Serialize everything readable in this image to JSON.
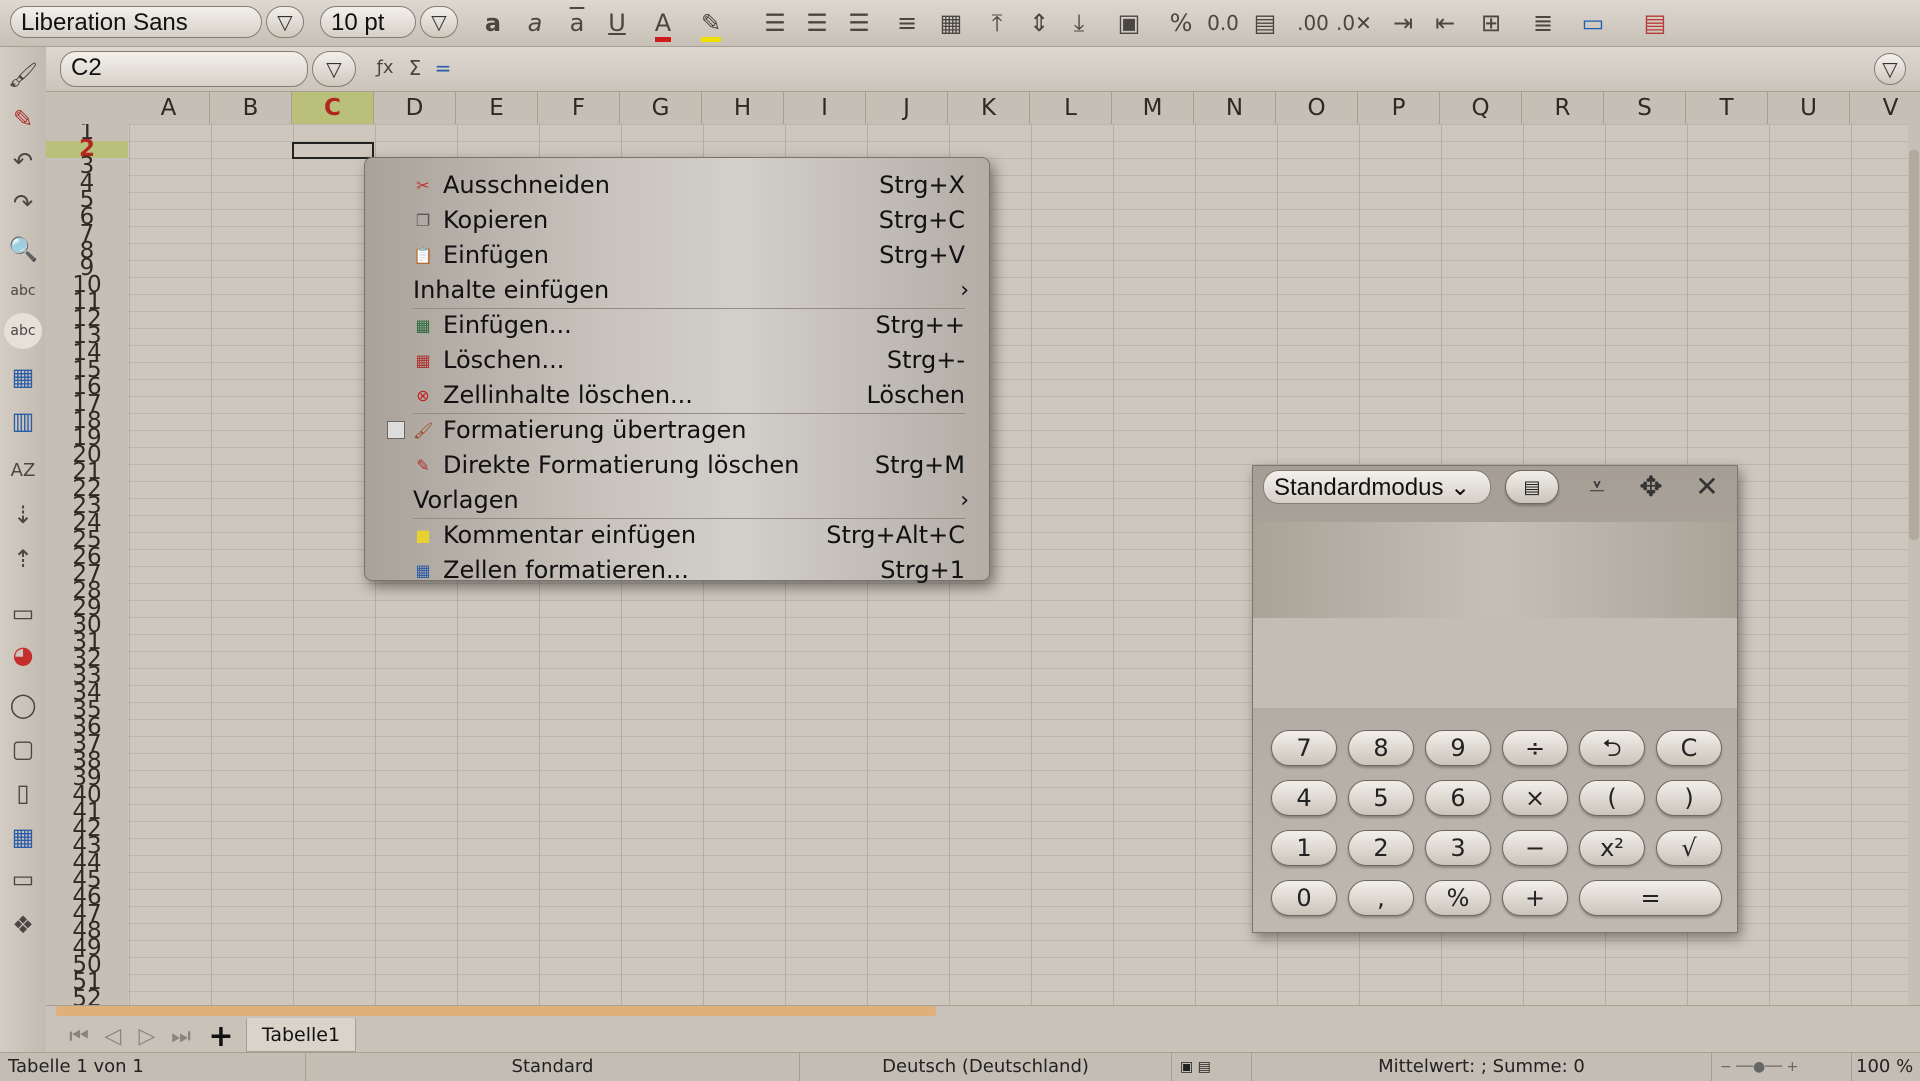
{
  "toolbar": {
    "font_name": "Liberation Sans",
    "font_size": "10 pt",
    "dropdown_glyph": "▽"
  },
  "formula_bar": {
    "name_box": "C2",
    "sum_label": "Σ",
    "equals_label": "="
  },
  "sheet": {
    "columns": [
      "A",
      "B",
      "C",
      "D",
      "E",
      "F",
      "G",
      "H",
      "I",
      "J",
      "K",
      "L",
      "M",
      "N",
      "O",
      "P",
      "Q",
      "R",
      "S",
      "T",
      "U",
      "V"
    ],
    "selected_column": "C",
    "rows": [
      "1",
      "2",
      "3",
      "4",
      "5",
      "6",
      "7",
      "8",
      "9",
      "10",
      "11",
      "12",
      "13",
      "14",
      "15",
      "16",
      "17",
      "18",
      "19",
      "20",
      "21",
      "22",
      "23",
      "24",
      "25",
      "26",
      "27",
      "28",
      "29",
      "30",
      "31",
      "32",
      "33",
      "34",
      "35",
      "36",
      "37",
      "38",
      "39",
      "40",
      "41",
      "42",
      "43",
      "44",
      "45",
      "46",
      "47",
      "48",
      "49",
      "50",
      "51",
      "52"
    ],
    "selected_row": "2",
    "tab_name": "Tabelle1"
  },
  "context_menu": {
    "items": [
      {
        "label": "Ausschneiden",
        "shortcut": "Strg+X",
        "icon": "scissors-icon"
      },
      {
        "label": "Kopieren",
        "shortcut": "Strg+C",
        "icon": "copy-icon"
      },
      {
        "label": "Einfügen",
        "shortcut": "Strg+V",
        "icon": "paste-icon"
      },
      {
        "label": "Inhalte einfügen",
        "shortcut": "",
        "icon": "",
        "submenu": true
      },
      {
        "label": "Einfügen...",
        "shortcut": "Strg++",
        "icon": "insert-cells-icon"
      },
      {
        "label": "Löschen...",
        "shortcut": "Strg+-",
        "icon": "delete-cells-icon"
      },
      {
        "label": "Zellinhalte löschen...",
        "shortcut": "Löschen",
        "icon": "clear-contents-icon"
      },
      {
        "label": "Formatierung übertragen",
        "shortcut": "",
        "icon": "clone-format-icon",
        "checkbox": true
      },
      {
        "label": "Direkte Formatierung löschen",
        "shortcut": "Strg+M",
        "icon": "clear-format-icon"
      },
      {
        "label": "Vorlagen",
        "shortcut": "",
        "icon": "",
        "submenu": true
      },
      {
        "label": "Kommentar einfügen",
        "shortcut": "Strg+Alt+C",
        "icon": "comment-icon"
      },
      {
        "label": "Zellen formatieren...",
        "shortcut": "Strg+1",
        "icon": "format-cells-icon"
      }
    ]
  },
  "calculator": {
    "mode": "Standardmodus",
    "keys": [
      [
        "7",
        "8",
        "9",
        "÷",
        "⮌",
        "C"
      ],
      [
        "4",
        "5",
        "6",
        "×",
        "(",
        ")"
      ],
      [
        "1",
        "2",
        "3",
        "−",
        "x²",
        "√"
      ],
      [
        "0",
        ",",
        "%",
        "+",
        "="
      ]
    ]
  },
  "status_bar": {
    "sheet_info": "Tabelle 1 von 1",
    "page_style": "Standard",
    "language": "Deutsch (Deutschland)",
    "summary": "Mittelwert: ; Summe: 0",
    "zoom": "100 %"
  },
  "colors": {
    "selection_header": "#b9c07a",
    "selection_text": "#b3261e",
    "scroll_accent": "#e0b07a"
  }
}
